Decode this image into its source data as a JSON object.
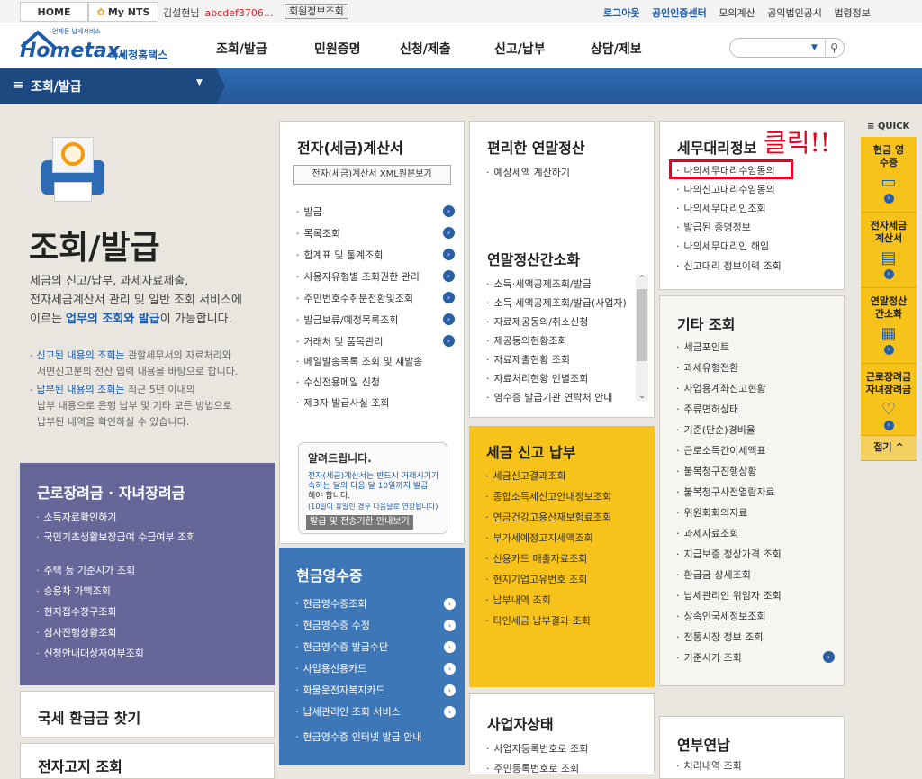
{
  "topbar": {
    "home": "HOME",
    "mynts": "My NTS",
    "welcome": "김설현님",
    "user_id": "abcdef3706...",
    "member_info_btn": "회원정보조회",
    "links": [
      "로그아웃",
      "공인인증센터",
      "모의계산",
      "공익법인공시",
      "법령정보"
    ]
  },
  "header": {
    "logo_main": "Hometax.",
    "logo_sub": "국세청홈택스",
    "logo_small": "언제든 납세서비스",
    "gnb": [
      "조회/발급",
      "민원증명",
      "신청/제출",
      "신고/납부",
      "상담/제보"
    ]
  },
  "navbar": {
    "current": "조회/발급"
  },
  "hero": {
    "title": "조회/발급",
    "desc_1": "세금의 신고/납부, 과세자료제출,",
    "desc_2": "전자세금계산서 관리 및 일반 조회 서비스에",
    "desc_3a": "이르는 ",
    "desc_3b": "업무의 조회와 발급",
    "desc_3c": "이 가능합니다.",
    "note1a": "신고된 내용의 조회는",
    "note1b": " 관할세무서의 자료처리와",
    "note1c": "서면신고분의 전산 입력 내용을 바탕으로 합니다.",
    "note2a": "납부된 내용의 조회는",
    "note2b": " 최근 5년 이내의",
    "note2c": "납부 내용으로 은행 납부 및 기타 모든 방법으로",
    "note2d": "납부된 내역을 확인하실 수 있습니다."
  },
  "einvoice": {
    "title": "전자(세금)계산서",
    "xml_btn": "전자(세금)계산서 XML원본보기",
    "items": [
      "발급",
      "목록조회",
      "합계표 및 통계조회",
      "사용자유형별 조회권한 관리",
      "주민번호수취분전환및조회",
      "발급보류/예정목록조회",
      "거래처 및 품목관리",
      "메일발송목록 조회 및 재발송",
      "수신전용메일 신청",
      "제3자 발급사실 조회"
    ],
    "notice_title": "알려드립니다.",
    "notice_1": "전자(세금)계산서는 반드시 거래시기가",
    "notice_2": "속하는 달의 다음 달 10일까지 발급",
    "notice_3": "해야 합니다.",
    "notice_4": "(10일이 휴일인 경우 다음날로 연장됩니다)",
    "notice_btn": "발급 및 전송기한 안내보기"
  },
  "yearend": {
    "title": "편리한 연말정산",
    "items": [
      "예상세액 계산하기"
    ]
  },
  "yearend_simple": {
    "title": "연말정산간소화",
    "items": [
      "소득·세액공제조회/발급",
      "소득·세액공제조회/발급(사업자)",
      "자료제공동의/취소신청",
      "제공동의현황조회",
      "자료제출현황 조회",
      "자료처리현황 인별조회",
      "영수증 발급기관 연락처 안내"
    ]
  },
  "agent": {
    "title": "세무대리정보",
    "annotation": "클릭!!",
    "items": [
      "나의세무대리수임동의",
      "나의신고대리수임동의",
      "나의세무대리인조회",
      "발급된 증명정보",
      "나의세무대리인 해임",
      "신고대리 정보이력 조회"
    ]
  },
  "other": {
    "title": "기타 조회",
    "items": [
      "세금포인트",
      "과세유형전환",
      "사업용계좌신고현황",
      "주류면허상태",
      "기준(단순)경비율",
      "근로소득간이세액표",
      "불복청구진행상황",
      "불복청구사전열람자료",
      "위원회회의자료",
      "과세자료조회",
      "지급보증 정상가격 조회",
      "환급금 상세조회",
      "납세관리인 위임자 조회",
      "상속인국세정보조회",
      "전통시장 정보 조회",
      "기준시가 조회"
    ]
  },
  "tax_report": {
    "title": "세금 신고 납부",
    "items": [
      "세금신고결과조회",
      "종합소득세신고안내정보조회",
      "연금건강고용산재보험료조회",
      "부가세예정고지세액조회",
      "신용카드 매출자료조회",
      "현지기업고유번호 조회",
      "납부내역 조회",
      "타인세금 납부결과 조회"
    ]
  },
  "cash_receipt": {
    "title": "현금영수증",
    "items": [
      "현금영수증조회",
      "현금영수증 수정",
      "현금영수증 발급수단",
      "사업용신용카드",
      "화물운전자복지카드",
      "납세관리인 조회 서비스",
      "현금영수증 인터넷 발급 안내"
    ]
  },
  "children": {
    "title": "근로장려금 · 자녀장려금",
    "items": [
      "소득자료확인하기",
      "국민기초생활보장급여 수급여부 조회",
      "주택 등 기준시가 조회",
      "승용차 가액조회",
      "현지접수창구조회",
      "심사진행상황조회",
      "신청안내대상자여부조회"
    ]
  },
  "refund": {
    "title": "국세 환급금 찾기"
  },
  "bizstatus": {
    "title": "사업자상태",
    "items": [
      "사업자등록번호로 조회",
      "주민등록번호로 조회"
    ]
  },
  "annuity": {
    "title": "연부연납",
    "items": [
      "처리내역 조회"
    ]
  },
  "etax": {
    "title": "전자고지 조회"
  },
  "quick": {
    "label": "QUICK",
    "items": [
      "현금 영수증",
      "전자세금 계산서",
      "연말정산 간소화",
      "근로장려금 자녀장려금"
    ],
    "close": "접기"
  },
  "colors": {
    "accent": "#1e5ca8",
    "yellow": "#f7c21a",
    "purple": "#676699",
    "blue": "#3e77b8",
    "red": "#e8001e"
  }
}
